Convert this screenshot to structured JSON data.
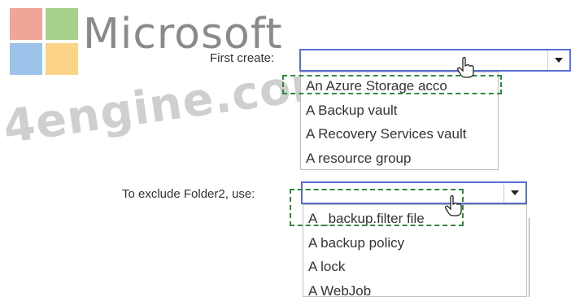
{
  "brand": {
    "wordmark": "Microsoft",
    "wordmark_color": "#8a8a8a",
    "logo_colors": {
      "red": "#f1a596",
      "green": "#a5d18a",
      "blue": "#9cc3ea",
      "yellow": "#fbd489"
    }
  },
  "watermark": {
    "text": "4engine.com",
    "color": "#cfcfcf"
  },
  "question1": {
    "label": "First create:",
    "selected_value": "",
    "options": [
      "An Azure Storage acco",
      "A Backup vault",
      "A Recovery Services vault",
      "A resource group"
    ]
  },
  "question2": {
    "label": "To exclude Folder2, use:",
    "selected_value": "",
    "options": [
      "A _backup.filter file",
      "A backup policy",
      "A lock",
      "A WebJob"
    ]
  },
  "icons": {
    "dropdown": "chevron-down-icon",
    "pointer": "hand-pointer-icon"
  },
  "colors": {
    "answer_dash": "#2e8b3a",
    "select_border": "#5a6fd0"
  }
}
